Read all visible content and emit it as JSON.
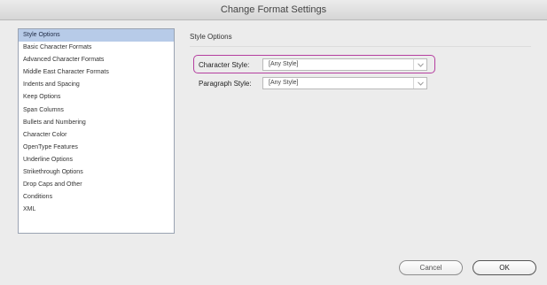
{
  "window": {
    "title": "Change Format Settings"
  },
  "sidebar": {
    "items": [
      {
        "label": "Style Options"
      },
      {
        "label": "Basic Character Formats"
      },
      {
        "label": "Advanced Character Formats"
      },
      {
        "label": "Middle East Character Formats"
      },
      {
        "label": "Indents and Spacing"
      },
      {
        "label": "Keep Options"
      },
      {
        "label": "Span Columns"
      },
      {
        "label": "Bullets and Numbering"
      },
      {
        "label": "Character Color"
      },
      {
        "label": "OpenType Features"
      },
      {
        "label": "Underline Options"
      },
      {
        "label": "Strikethrough Options"
      },
      {
        "label": "Drop Caps and Other"
      },
      {
        "label": "Conditions"
      },
      {
        "label": "XML"
      }
    ],
    "selected_index": 0
  },
  "main": {
    "title": "Style Options",
    "character_style": {
      "label": "Character Style:",
      "value": "[Any Style]"
    },
    "paragraph_style": {
      "label": "Paragraph Style:",
      "value": "[Any Style]"
    }
  },
  "buttons": {
    "cancel": "Cancel",
    "ok": "OK"
  },
  "colors": {
    "selection": "#b7cbe8",
    "highlight": "#b53fa0"
  },
  "icons": {
    "select_arrow": "chevron-down-icon"
  }
}
